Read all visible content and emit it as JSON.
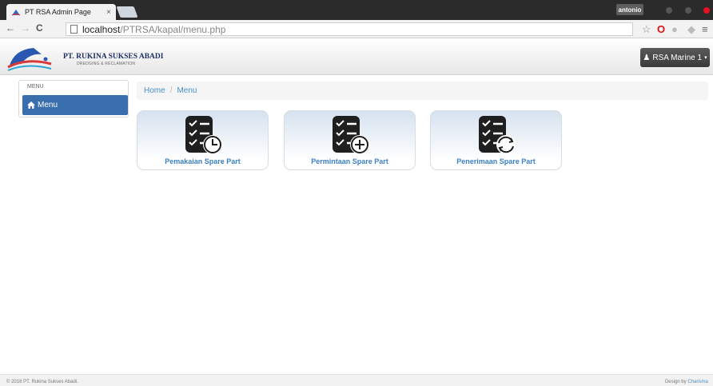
{
  "browser": {
    "tab_title": "PT RSA Admin Page",
    "tab_close": "×",
    "profile_name": "antonio",
    "url_host": "localhost",
    "url_path": "/PTRSA/kapal/menu.php"
  },
  "header": {
    "company_name": "PT. RUKINA SUKSES ABADI",
    "company_tagline": "DREDGING & RECLAMATION",
    "user_button": "RSA Marine 1"
  },
  "sidebar": {
    "title": "MENU",
    "items": [
      {
        "label": "Menu",
        "icon": "home-icon"
      }
    ]
  },
  "breadcrumb": {
    "home": "Home",
    "separator": "/",
    "current": "Menu"
  },
  "tiles": [
    {
      "label": "Pemakaian Spare Part",
      "icon": "checklist-clock-icon"
    },
    {
      "label": "Permintaan Spare Part",
      "icon": "checklist-add-icon"
    },
    {
      "label": "Penerimaan Spare Part",
      "icon": "checklist-refresh-icon"
    }
  ],
  "footer": {
    "copyright": "© 2016 PT. Rukina Sukses Abadi.",
    "design_by": "Design by",
    "designer": "Charisma"
  },
  "colors": {
    "accent": "#3a6fae",
    "link": "#4a90c8",
    "tile_label": "#3b7fc4"
  }
}
